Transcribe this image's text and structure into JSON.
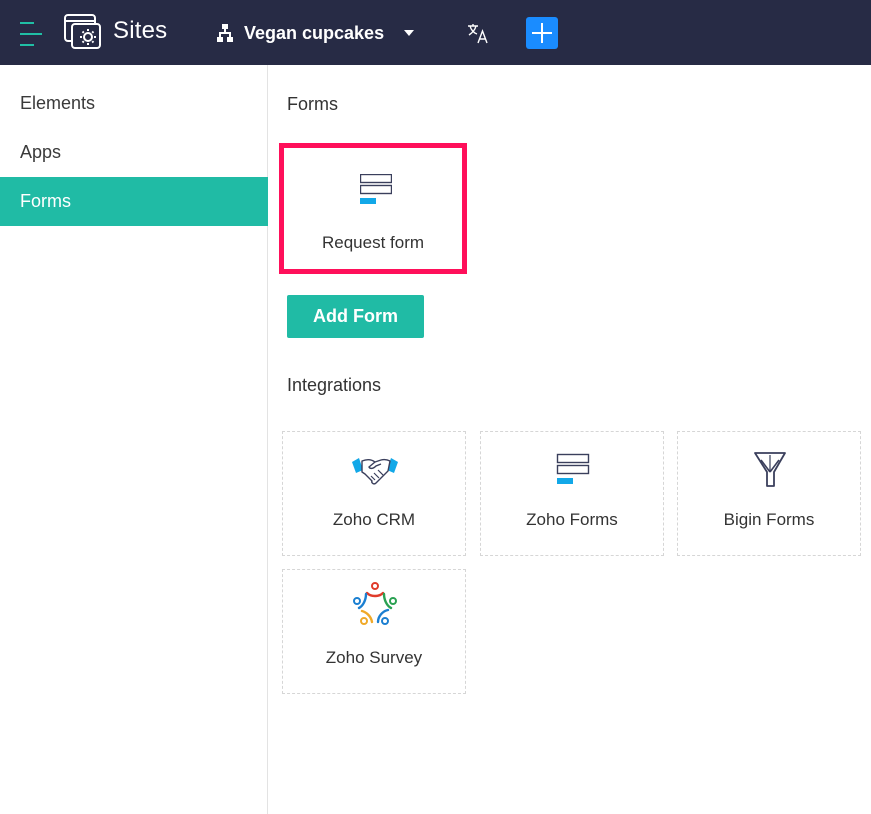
{
  "header": {
    "app_title": "Sites",
    "site_name": "Vegan cupcakes",
    "icons": {
      "menu": "hamburger-menu-icon",
      "logo": "sites-logo-icon",
      "site": "sitemap-tree-icon",
      "dropdown": "chevron-down-icon",
      "translate": "translate-icon",
      "add": "plus-icon"
    }
  },
  "sidebar": {
    "items": [
      {
        "label": "Elements",
        "active": false
      },
      {
        "label": "Apps",
        "active": false
      },
      {
        "label": "Forms",
        "active": true
      }
    ]
  },
  "main": {
    "forms_title": "Forms",
    "forms": [
      {
        "label": "Request form",
        "icon": "form-icon",
        "selected": true
      }
    ],
    "add_form_label": "Add Form",
    "integrations_title": "Integrations",
    "integrations": [
      {
        "label": "Zoho CRM",
        "icon": "handshake-icon"
      },
      {
        "label": "Zoho Forms",
        "icon": "form-icon"
      },
      {
        "label": "Bigin Forms",
        "icon": "bigin-logo-icon"
      },
      {
        "label": "Zoho Survey",
        "icon": "survey-logo-icon"
      }
    ]
  },
  "colors": {
    "topbar": "#272b45",
    "accent": "#20bba5",
    "add_button": "#1a8cff",
    "highlight": "#ff0f5a",
    "icon_blue": "#12a8e8"
  }
}
